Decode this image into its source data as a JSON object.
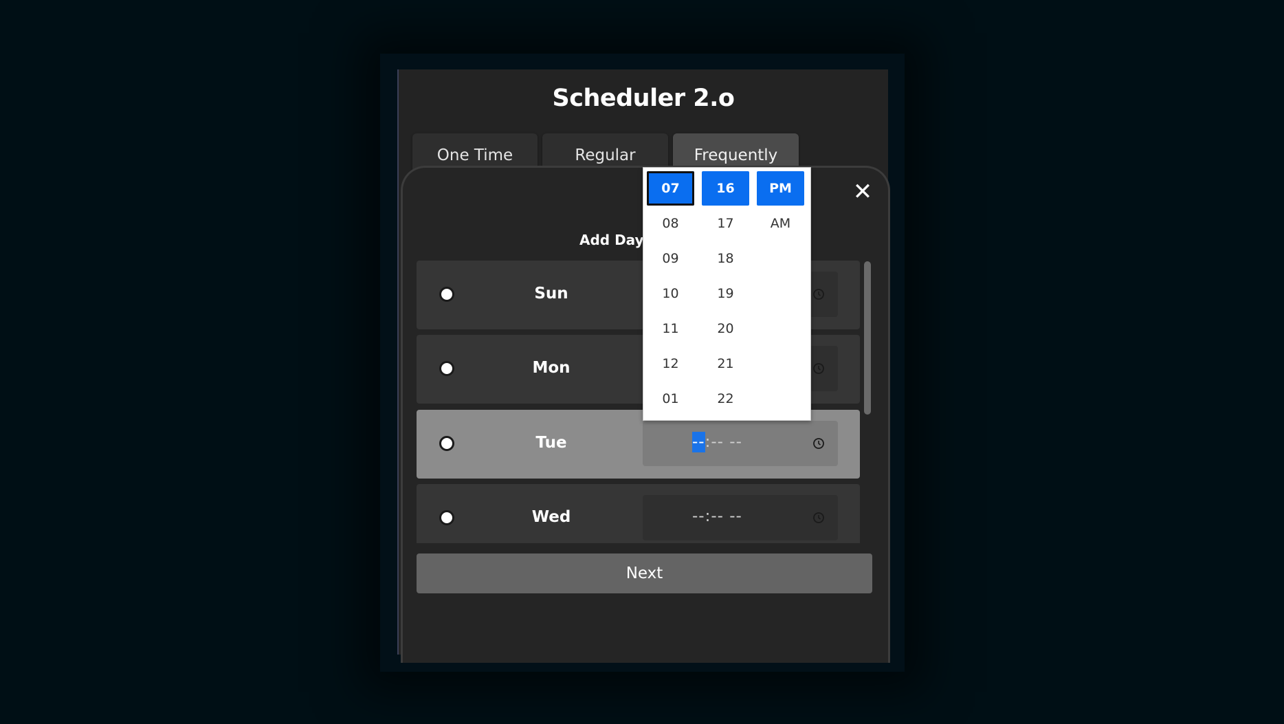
{
  "app": {
    "title": "Scheduler 2.o"
  },
  "tabs": [
    {
      "label": "One Time",
      "active": false
    },
    {
      "label": "Regular",
      "active": false
    },
    {
      "label": "Frequently",
      "active": true
    }
  ],
  "modal": {
    "close_icon": "close-icon",
    "add_day_label": "Add Day",
    "days": [
      {
        "label": "Sun",
        "time_placeholder": "--:-- --",
        "selected": false
      },
      {
        "label": "Mon",
        "time_placeholder": "--:-- --",
        "selected": false
      },
      {
        "label": "Tue",
        "time_hour_segment": "--",
        "time_rest": ":-- --",
        "selected": true
      },
      {
        "label": "Wed",
        "time_placeholder": "--:-- --",
        "selected": false
      }
    ],
    "next_label": "Next"
  },
  "time_picker": {
    "hours": [
      "07",
      "08",
      "09",
      "10",
      "11",
      "12",
      "01"
    ],
    "minutes": [
      "16",
      "17",
      "18",
      "19",
      "20",
      "21",
      "22"
    ],
    "periods": [
      "PM",
      "AM"
    ],
    "selected_hour": "07",
    "selected_minute": "16",
    "selected_period": "PM"
  },
  "colors": {
    "accent": "#0a6ef0",
    "background": "#000f15",
    "panel": "#232323"
  }
}
